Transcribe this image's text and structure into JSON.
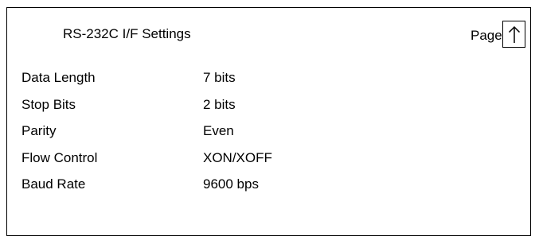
{
  "screen": {
    "title": "RS-232C I/F Settings",
    "page_label": "Page",
    "page_button_icon": "arrow-up-icon"
  },
  "settings": [
    {
      "label": "Data Length",
      "value": "7 bits"
    },
    {
      "label": "Stop Bits",
      "value": "2 bits"
    },
    {
      "label": "Parity",
      "value": "Even"
    },
    {
      "label": "Flow Control",
      "value": "XON/XOFF"
    },
    {
      "label": "Baud Rate",
      "value": "9600 bps"
    }
  ]
}
